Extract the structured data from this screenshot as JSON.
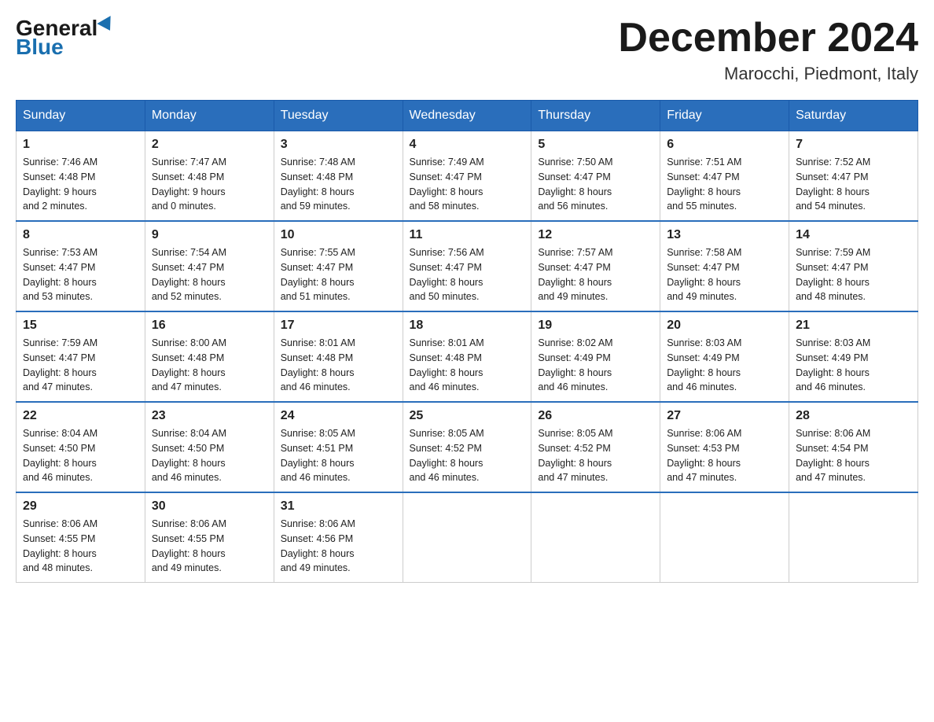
{
  "header": {
    "logo": {
      "general": "General",
      "blue": "Blue"
    },
    "title": "December 2024",
    "location": "Marocchi, Piedmont, Italy"
  },
  "days_of_week": [
    "Sunday",
    "Monday",
    "Tuesday",
    "Wednesday",
    "Thursday",
    "Friday",
    "Saturday"
  ],
  "weeks": [
    [
      {
        "day": "1",
        "sunrise": "7:46 AM",
        "sunset": "4:48 PM",
        "daylight": "9 hours and 2 minutes."
      },
      {
        "day": "2",
        "sunrise": "7:47 AM",
        "sunset": "4:48 PM",
        "daylight": "9 hours and 0 minutes."
      },
      {
        "day": "3",
        "sunrise": "7:48 AM",
        "sunset": "4:48 PM",
        "daylight": "8 hours and 59 minutes."
      },
      {
        "day": "4",
        "sunrise": "7:49 AM",
        "sunset": "4:47 PM",
        "daylight": "8 hours and 58 minutes."
      },
      {
        "day": "5",
        "sunrise": "7:50 AM",
        "sunset": "4:47 PM",
        "daylight": "8 hours and 56 minutes."
      },
      {
        "day": "6",
        "sunrise": "7:51 AM",
        "sunset": "4:47 PM",
        "daylight": "8 hours and 55 minutes."
      },
      {
        "day": "7",
        "sunrise": "7:52 AM",
        "sunset": "4:47 PM",
        "daylight": "8 hours and 54 minutes."
      }
    ],
    [
      {
        "day": "8",
        "sunrise": "7:53 AM",
        "sunset": "4:47 PM",
        "daylight": "8 hours and 53 minutes."
      },
      {
        "day": "9",
        "sunrise": "7:54 AM",
        "sunset": "4:47 PM",
        "daylight": "8 hours and 52 minutes."
      },
      {
        "day": "10",
        "sunrise": "7:55 AM",
        "sunset": "4:47 PM",
        "daylight": "8 hours and 51 minutes."
      },
      {
        "day": "11",
        "sunrise": "7:56 AM",
        "sunset": "4:47 PM",
        "daylight": "8 hours and 50 minutes."
      },
      {
        "day": "12",
        "sunrise": "7:57 AM",
        "sunset": "4:47 PM",
        "daylight": "8 hours and 49 minutes."
      },
      {
        "day": "13",
        "sunrise": "7:58 AM",
        "sunset": "4:47 PM",
        "daylight": "8 hours and 49 minutes."
      },
      {
        "day": "14",
        "sunrise": "7:59 AM",
        "sunset": "4:47 PM",
        "daylight": "8 hours and 48 minutes."
      }
    ],
    [
      {
        "day": "15",
        "sunrise": "7:59 AM",
        "sunset": "4:47 PM",
        "daylight": "8 hours and 47 minutes."
      },
      {
        "day": "16",
        "sunrise": "8:00 AM",
        "sunset": "4:48 PM",
        "daylight": "8 hours and 47 minutes."
      },
      {
        "day": "17",
        "sunrise": "8:01 AM",
        "sunset": "4:48 PM",
        "daylight": "8 hours and 46 minutes."
      },
      {
        "day": "18",
        "sunrise": "8:01 AM",
        "sunset": "4:48 PM",
        "daylight": "8 hours and 46 minutes."
      },
      {
        "day": "19",
        "sunrise": "8:02 AM",
        "sunset": "4:49 PM",
        "daylight": "8 hours and 46 minutes."
      },
      {
        "day": "20",
        "sunrise": "8:03 AM",
        "sunset": "4:49 PM",
        "daylight": "8 hours and 46 minutes."
      },
      {
        "day": "21",
        "sunrise": "8:03 AM",
        "sunset": "4:49 PM",
        "daylight": "8 hours and 46 minutes."
      }
    ],
    [
      {
        "day": "22",
        "sunrise": "8:04 AM",
        "sunset": "4:50 PM",
        "daylight": "8 hours and 46 minutes."
      },
      {
        "day": "23",
        "sunrise": "8:04 AM",
        "sunset": "4:50 PM",
        "daylight": "8 hours and 46 minutes."
      },
      {
        "day": "24",
        "sunrise": "8:05 AM",
        "sunset": "4:51 PM",
        "daylight": "8 hours and 46 minutes."
      },
      {
        "day": "25",
        "sunrise": "8:05 AM",
        "sunset": "4:52 PM",
        "daylight": "8 hours and 46 minutes."
      },
      {
        "day": "26",
        "sunrise": "8:05 AM",
        "sunset": "4:52 PM",
        "daylight": "8 hours and 47 minutes."
      },
      {
        "day": "27",
        "sunrise": "8:06 AM",
        "sunset": "4:53 PM",
        "daylight": "8 hours and 47 minutes."
      },
      {
        "day": "28",
        "sunrise": "8:06 AM",
        "sunset": "4:54 PM",
        "daylight": "8 hours and 47 minutes."
      }
    ],
    [
      {
        "day": "29",
        "sunrise": "8:06 AM",
        "sunset": "4:55 PM",
        "daylight": "8 hours and 48 minutes."
      },
      {
        "day": "30",
        "sunrise": "8:06 AM",
        "sunset": "4:55 PM",
        "daylight": "8 hours and 49 minutes."
      },
      {
        "day": "31",
        "sunrise": "8:06 AM",
        "sunset": "4:56 PM",
        "daylight": "8 hours and 49 minutes."
      },
      null,
      null,
      null,
      null
    ]
  ]
}
